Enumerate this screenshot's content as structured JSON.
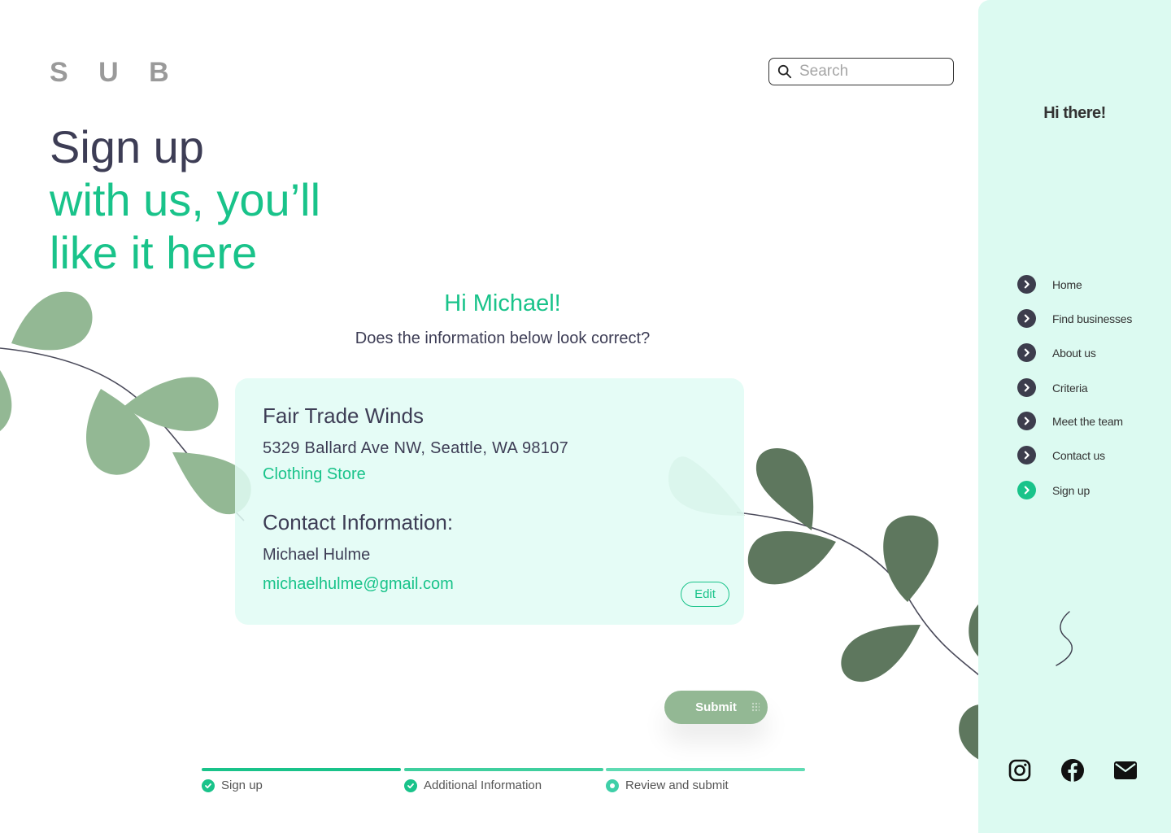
{
  "brand": {
    "logo": "S U B"
  },
  "search": {
    "placeholder": "Search"
  },
  "hero": {
    "line1": "Sign up",
    "line2": "with us, you’ll",
    "line3": "like it here"
  },
  "review": {
    "greeting": "Hi Michael!",
    "question": "Does the information below look correct?"
  },
  "card": {
    "business_name": "Fair Trade Winds",
    "address": "5329 Ballard Ave NW, Seattle, WA 98107",
    "category": "Clothing Store",
    "contact_heading": "Contact Information:",
    "contact_name": "Michael Hulme",
    "contact_email": "michaelhulme@gmail.com",
    "edit_label": "Edit"
  },
  "submit_label": "Submit",
  "progress": {
    "steps": [
      {
        "label": "Sign up",
        "status": "complete"
      },
      {
        "label": "Additional Information",
        "status": "complete"
      },
      {
        "label": "Review and submit",
        "status": "current"
      }
    ]
  },
  "sidebar": {
    "greeting": "Hi there!",
    "nav": [
      {
        "label": "Home",
        "active": false
      },
      {
        "label": "Find businesses",
        "active": false
      },
      {
        "label": "About us",
        "active": false
      },
      {
        "label": "Criteria",
        "active": false
      },
      {
        "label": "Meet the team",
        "active": false
      },
      {
        "label": "Contact us",
        "active": false
      },
      {
        "label": "Sign up",
        "active": true
      }
    ],
    "social": [
      "instagram-icon",
      "facebook-icon",
      "mail-icon"
    ]
  },
  "colors": {
    "accent": "#19c38a",
    "text": "#3d3d55",
    "sidebar_bg": "#dcfaf1",
    "card_bg": "#e0fcf4",
    "leaf_light": "#93b894",
    "leaf_dark": "#5e775e",
    "submit_bg": "#93b894"
  }
}
